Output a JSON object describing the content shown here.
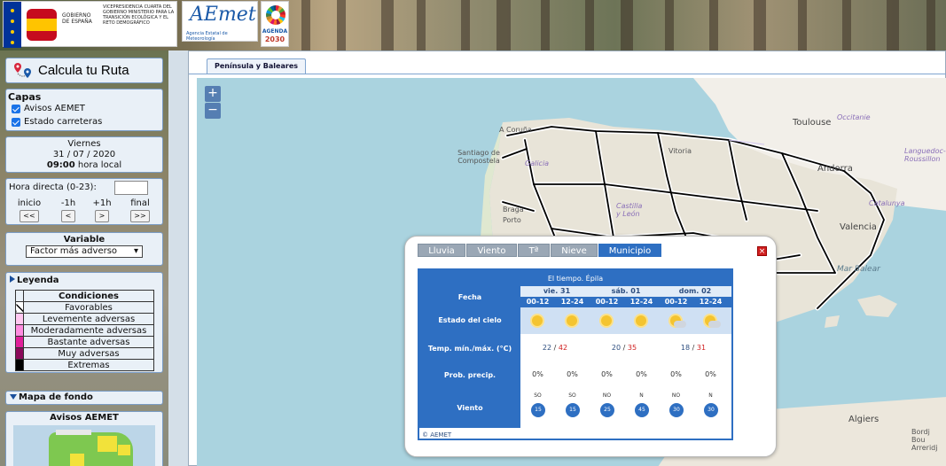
{
  "header": {
    "gov_left": "GOBIERNO DE ESPAÑA",
    "gov_right": "VICEPRESIDENCIA CUARTA DEL GOBIERNO MINISTERIO PARA LA TRANSICIÓN ECOLÓGICA Y EL RETO DEMOGRÁFICO",
    "aemet_logo": "AEmet",
    "aemet_sub": "Agencia Estatal de Meteorología",
    "agenda_top": "AGENDA",
    "agenda_year": "2030"
  },
  "sidebar": {
    "route_label": "Calcula tu Ruta",
    "layers_title": "Capas",
    "layers": [
      {
        "label": "Avisos AEMET",
        "checked": true
      },
      {
        "label": "Estado carreteras",
        "checked": true
      }
    ],
    "date": {
      "weekday": "Viernes",
      "date": "31 / 07 / 2020",
      "time": "09:00",
      "time_suffix": "hora local"
    },
    "hour": {
      "label": "Hora directa (0-23):",
      "input_value": "",
      "nav": [
        {
          "label": "inicio",
          "button": "<<"
        },
        {
          "label": "-1h",
          "button": "<"
        },
        {
          "label": "+1h",
          "button": ">"
        },
        {
          "label": "final",
          "button": ">>"
        }
      ]
    },
    "variable": {
      "title": "Variable",
      "selected": "Factor más adverso"
    },
    "legend": {
      "title": "Leyenda",
      "header": "Condiciones",
      "rows": [
        {
          "label": "Favorables",
          "color": "#ffffff"
        },
        {
          "label": "Levemente adversas",
          "color": "#ffc8f0"
        },
        {
          "label": "Moderadamente adversas",
          "color": "#ff8ce0"
        },
        {
          "label": "Bastante adversas",
          "color": "#e0209a"
        },
        {
          "label": "Muy adversas",
          "color": "#8a0a5a"
        },
        {
          "label": "Extremas",
          "color": "#000000"
        }
      ]
    },
    "fondo_title": "Mapa de fondo",
    "avisos_title": "Avisos AEMET"
  },
  "main": {
    "tab": "Península y Baleares",
    "zoom_in": "+",
    "zoom_out": "−",
    "map_labels": {
      "toulouse": "Toulouse",
      "occitanie": "Occitanie",
      "a_coruna": "A Coruña",
      "santiago": "Santiago de Compostela",
      "galicia": "Galicia",
      "vitoria": "Vitoria",
      "andorra": "Andorra",
      "catalunya": "Catalunya",
      "castilla": "Castilla y León",
      "braga": "Braga",
      "porto": "Porto",
      "mar_balear": "Mar Balear",
      "valencia": "Valencia",
      "algiers": "Algiers",
      "arreridj": "Bordj Bou Arreridj",
      "roussillon": "Languedoc-Roussillon"
    }
  },
  "popup": {
    "tabs": [
      "Lluvia",
      "Viento",
      "Tª",
      "Nieve",
      "Municipio"
    ],
    "active_tab": "Municipio",
    "title": "El tiempo. Épila",
    "row_labels": {
      "fecha": "Fecha",
      "estado": "Estado del cielo",
      "temp": "Temp. mín./máx. (°C)",
      "precip": "Prob. precip.",
      "viento": "Viento"
    },
    "days": [
      {
        "label": "vie. 31",
        "tmin": "22",
        "tmax": "42"
      },
      {
        "label": "sáb. 01",
        "tmin": "20",
        "tmax": "35"
      },
      {
        "label": "dom. 02",
        "tmin": "18",
        "tmax": "31"
      }
    ],
    "periods": [
      {
        "hours": "00-12",
        "sky": "sun",
        "precip": "0%",
        "wind_dir": "SO",
        "wind_speed": "15"
      },
      {
        "hours": "12-24",
        "sky": "sun",
        "precip": "0%",
        "wind_dir": "SO",
        "wind_speed": "15"
      },
      {
        "hours": "00-12",
        "sky": "sun",
        "precip": "0%",
        "wind_dir": "NO",
        "wind_speed": "25"
      },
      {
        "hours": "12-24",
        "sky": "sun",
        "precip": "0%",
        "wind_dir": "N",
        "wind_speed": "45"
      },
      {
        "hours": "00-12",
        "sky": "sun-cloud",
        "precip": "0%",
        "wind_dir": "NO",
        "wind_speed": "30"
      },
      {
        "hours": "12-24",
        "sky": "sun-cloud",
        "precip": "0%",
        "wind_dir": "N",
        "wind_speed": "30"
      }
    ],
    "copyright": "© AEMET",
    "close": "×"
  }
}
